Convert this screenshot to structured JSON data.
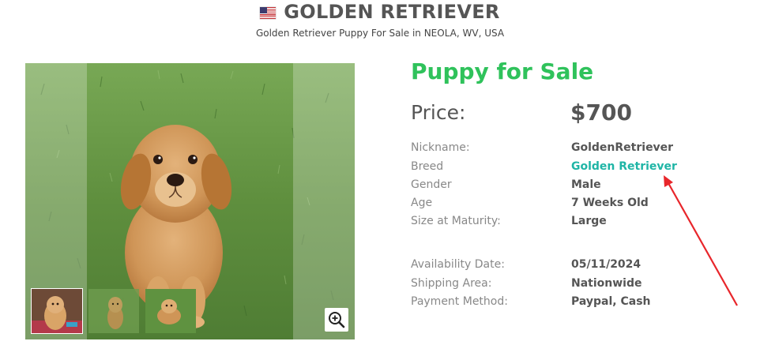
{
  "header": {
    "flag_icon": "us-flag-icon",
    "title": "GOLDEN RETRIEVER",
    "subtitle": "Golden Retriever Puppy For Sale in NEOLA, WV, USA"
  },
  "gallery": {
    "main_image": "golden-retriever-puppy-photo",
    "thumbnails": [
      "puppy-thumbnail-1",
      "puppy-thumbnail-2",
      "puppy-thumbnail-3"
    ],
    "zoom_icon": "zoom-in-icon"
  },
  "details": {
    "heading": "Puppy for Sale",
    "price_label": "Price:",
    "price_value": "$700",
    "specs": [
      {
        "label": "Nickname:",
        "value": "GoldenRetriever"
      },
      {
        "label": "Breed",
        "value": "Golden Retriever"
      },
      {
        "label": "Gender",
        "value": "Male"
      },
      {
        "label": "Age",
        "value": "7 Weeks Old"
      },
      {
        "label": "Size at Maturity:",
        "value": "Large"
      },
      {
        "label": "Availability Date:",
        "value": "05/11/2024"
      },
      {
        "label": "Shipping Area:",
        "value": "Nationwide"
      },
      {
        "label": "Payment Method:",
        "value": "Paypal, Cash"
      }
    ]
  },
  "colors": {
    "heading_green": "#2fc25b",
    "breed_link_teal": "#1fb5a6",
    "annotation_red": "#e8262b"
  }
}
